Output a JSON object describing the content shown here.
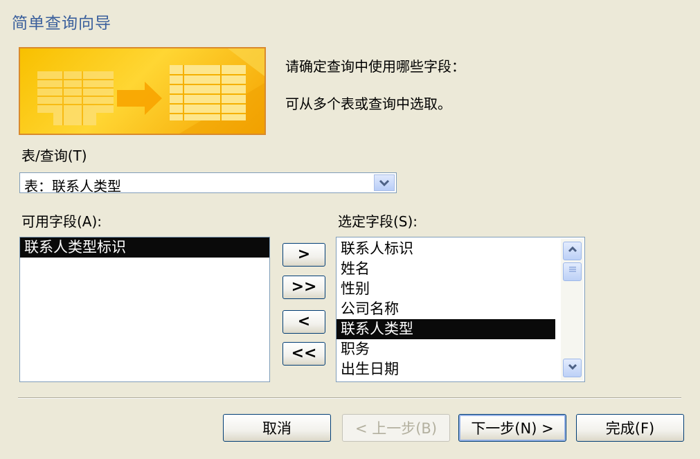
{
  "window": {
    "title": "简单查询向导"
  },
  "instructions": {
    "line1": "请确定查询中使用哪些字段：",
    "line2": "可从多个表或查询中选取。"
  },
  "source": {
    "label": "表/查询(T)",
    "value": "表：联系人类型"
  },
  "available": {
    "label": "可用字段(A):",
    "items": [
      "联系人类型标识"
    ]
  },
  "selected": {
    "label": "选定字段(S):",
    "items": [
      "联系人标识",
      "姓名",
      "性别",
      "公司名称",
      "联系人类型",
      "职务",
      "出生日期"
    ]
  },
  "move_buttons": {
    "add_one": ">",
    "add_all": ">>",
    "remove_one": "<",
    "remove_all": "<<"
  },
  "footer": {
    "cancel": "取消",
    "back": "< 上一步(B)",
    "next": "下一步(N) >",
    "finish": "完成(F)"
  },
  "colors": {
    "title_text": "#3a5f9c",
    "selection": "#0a0a0a",
    "banner": "#f8c000"
  }
}
